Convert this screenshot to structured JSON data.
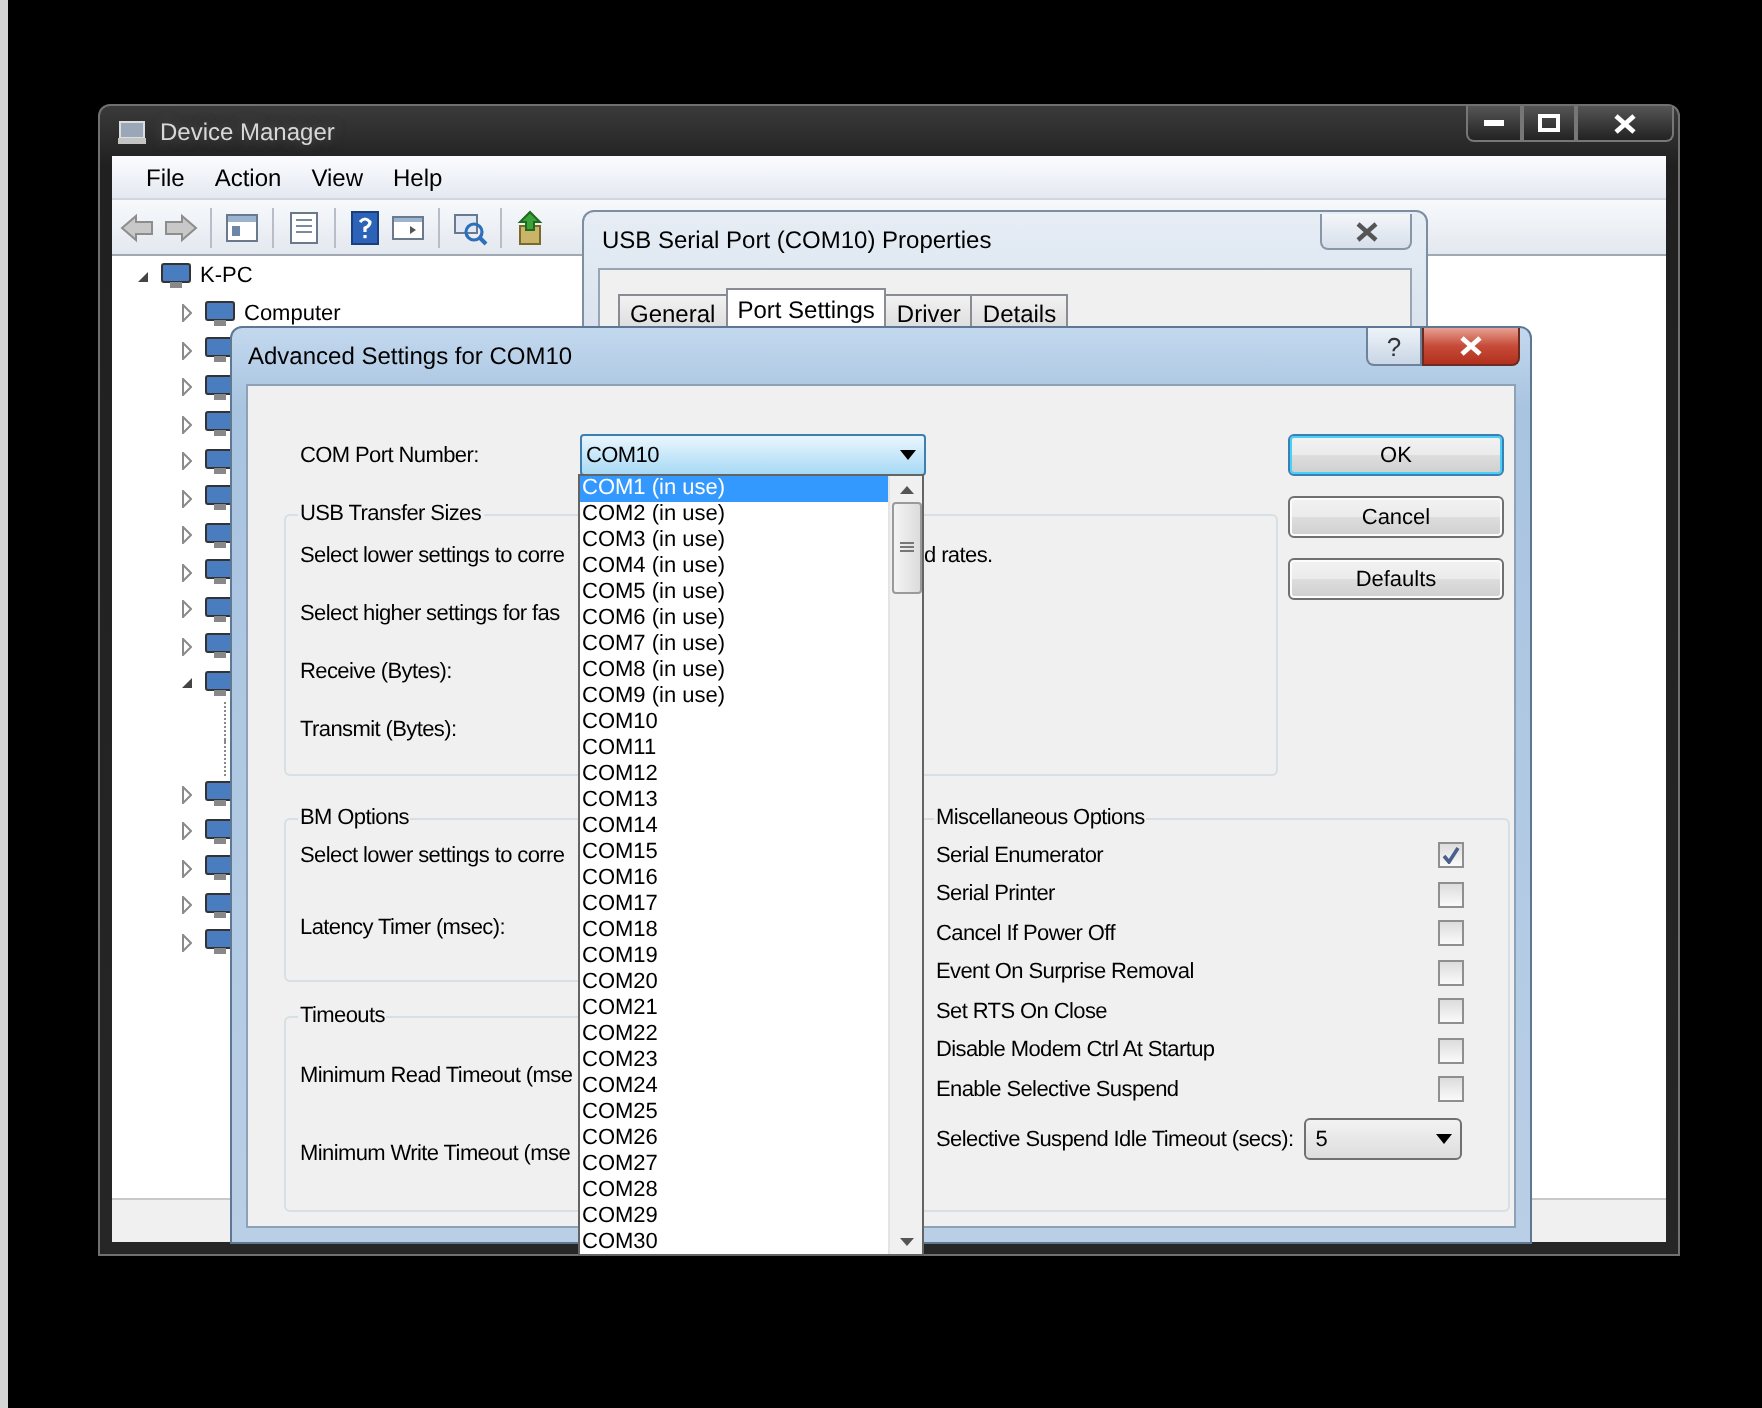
{
  "device_manager": {
    "title": "Device Manager",
    "menu": [
      "File",
      "Action",
      "View",
      "Help"
    ],
    "tree": {
      "label": "K-PC",
      "expanded": true,
      "children": [
        {
          "label": "Computer",
          "expanded": false
        },
        {
          "expanded": false
        },
        {
          "expanded": false
        },
        {
          "expanded": false
        },
        {
          "expanded": false
        },
        {
          "expanded": false
        },
        {
          "expanded": false
        },
        {
          "expanded": false
        },
        {
          "expanded": false
        },
        {
          "expanded": false
        },
        {
          "expanded": true,
          "children": [
            {
              "kind": "device"
            },
            {
              "kind": "device"
            }
          ]
        },
        {
          "expanded": false
        },
        {
          "expanded": false
        },
        {
          "expanded": false
        },
        {
          "expanded": false
        },
        {
          "expanded": false
        }
      ]
    }
  },
  "properties_window": {
    "title": "USB Serial Port (COM10) Properties",
    "tabs": [
      {
        "label": "General",
        "selected": false
      },
      {
        "label": "Port Settings",
        "selected": true
      },
      {
        "label": "Driver",
        "selected": false
      },
      {
        "label": "Details",
        "selected": false
      }
    ]
  },
  "advanced_dialog": {
    "title": "Advanced Settings for COM10",
    "help_button": "?",
    "com_port": {
      "label": "COM Port Number:",
      "value": "COM10",
      "open": true
    },
    "buttons": [
      {
        "label": "OK",
        "focused": true
      },
      {
        "label": "Cancel",
        "focused": false
      },
      {
        "label": "Defaults",
        "focused": false
      }
    ],
    "usb_transfer_sizes": {
      "title": "USB Transfer Sizes",
      "rows": [
        {
          "label": "Select lower settings to corre",
          "trailing": "d rates."
        },
        {
          "label": "Select higher settings for fas"
        },
        {
          "label": "Receive (Bytes):"
        },
        {
          "label": "Transmit (Bytes):"
        }
      ]
    },
    "bm_options": {
      "title": "BM Options",
      "rows": [
        "Select lower settings to corre",
        "Latency Timer (msec):"
      ]
    },
    "timeouts": {
      "title": "Timeouts",
      "rows": [
        "Minimum Read Timeout (mse",
        "Minimum Write Timeout (mse"
      ]
    },
    "miscellaneous_options": {
      "title": "Miscellaneous Options",
      "items": [
        {
          "kind": "checkbox",
          "label": "Serial Enumerator",
          "checked": true
        },
        {
          "kind": "checkbox",
          "label": "Serial Printer",
          "checked": false
        },
        {
          "kind": "checkbox",
          "label": "Cancel If Power Off",
          "checked": false
        },
        {
          "kind": "checkbox",
          "label": "Event On Surprise Removal",
          "checked": false
        },
        {
          "kind": "checkbox",
          "label": "Set RTS On Close",
          "checked": false
        },
        {
          "kind": "checkbox",
          "label": "Disable Modem Ctrl At Startup",
          "checked": false
        },
        {
          "kind": "checkbox",
          "label": "Enable Selective Suspend",
          "checked": false
        },
        {
          "kind": "dropdown",
          "label": "Selective Suspend Idle Timeout (secs):",
          "value": "5"
        }
      ]
    },
    "com_port_list": [
      {
        "label": "COM1 (in use)",
        "selected": true
      },
      {
        "label": "COM2 (in use)",
        "selected": false
      },
      {
        "label": "COM3 (in use)",
        "selected": false
      },
      {
        "label": "COM4 (in use)",
        "selected": false
      },
      {
        "label": "COM5 (in use)",
        "selected": false
      },
      {
        "label": "COM6 (in use)",
        "selected": false
      },
      {
        "label": "COM7 (in use)",
        "selected": false
      },
      {
        "label": "COM8 (in use)",
        "selected": false
      },
      {
        "label": "COM9 (in use)",
        "selected": false
      },
      {
        "label": "COM10",
        "selected": false
      },
      {
        "label": "COM11",
        "selected": false
      },
      {
        "label": "COM12",
        "selected": false
      },
      {
        "label": "COM13",
        "selected": false
      },
      {
        "label": "COM14",
        "selected": false
      },
      {
        "label": "COM15",
        "selected": false
      },
      {
        "label": "COM16",
        "selected": false
      },
      {
        "label": "COM17",
        "selected": false
      },
      {
        "label": "COM18",
        "selected": false
      },
      {
        "label": "COM19",
        "selected": false
      },
      {
        "label": "COM20",
        "selected": false
      },
      {
        "label": "COM21",
        "selected": false
      },
      {
        "label": "COM22",
        "selected": false
      },
      {
        "label": "COM23",
        "selected": false
      },
      {
        "label": "COM24",
        "selected": false
      },
      {
        "label": "COM25",
        "selected": false
      },
      {
        "label": "COM26",
        "selected": false
      },
      {
        "label": "COM27",
        "selected": false
      },
      {
        "label": "COM28",
        "selected": false
      },
      {
        "label": "COM29",
        "selected": false
      },
      {
        "label": "COM30",
        "selected": false
      }
    ]
  }
}
